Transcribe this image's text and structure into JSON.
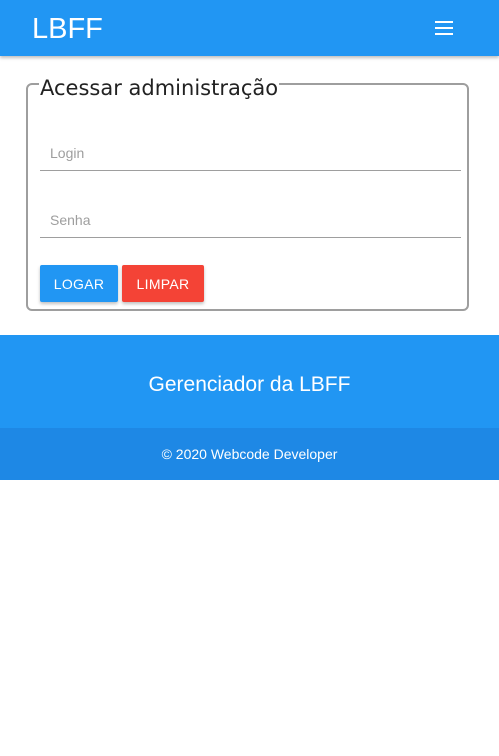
{
  "navbar": {
    "brand": "LBFF",
    "menu_icon": "hamburger-menu-icon",
    "background": "#2196f3"
  },
  "login_form": {
    "legend": "Acessar administração",
    "login_placeholder": "Login",
    "login_value": "",
    "senha_placeholder": "Senha",
    "senha_value": "",
    "logar_label": "LOGAR",
    "limpar_label": "LIMPAR"
  },
  "footer": {
    "title": "Gerenciador da LBFF",
    "copyright": "© 2020 Webcode Developer"
  },
  "colors": {
    "primary": "#2196f3",
    "danger": "#f44336",
    "footer_dark": "#1e88e5"
  }
}
